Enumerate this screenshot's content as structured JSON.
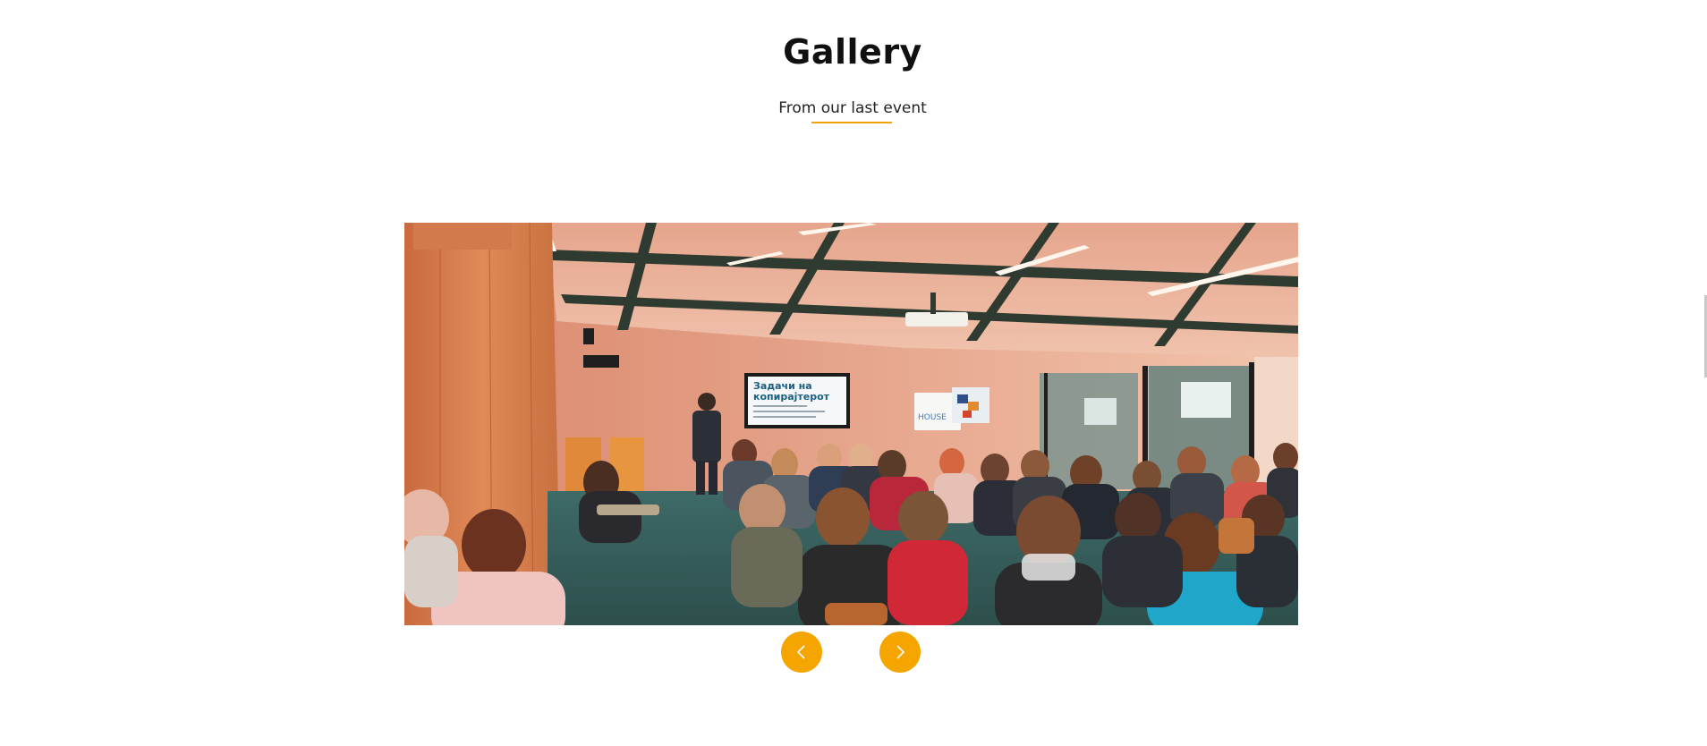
{
  "gallery": {
    "title": "Gallery",
    "subtitle": "From our last event",
    "accent_color": "#f5a500",
    "slide": {
      "screen_text_line1": "Задачи на",
      "screen_text_line2": "копирајтерот",
      "sign_text": "HOUSE"
    },
    "controls": {
      "prev_icon": "chevron-left-icon",
      "next_icon": "chevron-right-icon"
    }
  }
}
